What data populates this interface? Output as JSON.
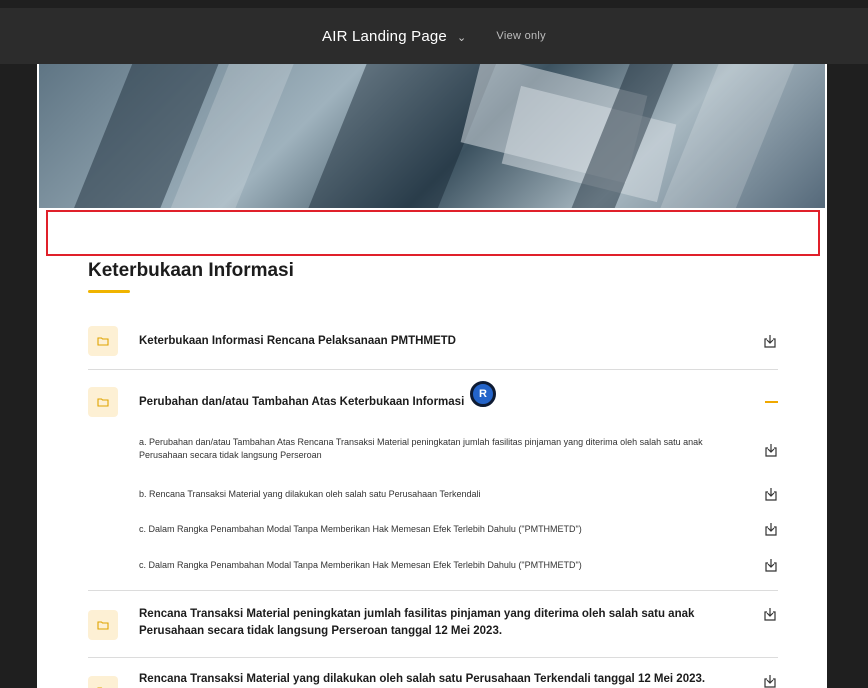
{
  "topbar": {
    "title": "AIR Landing Page",
    "chevron_icon": "chevron-down-icon",
    "mode": "View only"
  },
  "section": {
    "title": "Keterbukaan Informasi"
  },
  "items": [
    {
      "label": "Keterbukaan Informasi Rencana Pelaksanaan PMTHMETD",
      "action": "download-icon"
    },
    {
      "label": "Perubahan dan/atau Tambahan Atas Keterbukaan Informasi",
      "action": "collapse-icon",
      "children": [
        {
          "label": "a. Perubahan dan/atau Tambahan Atas Rencana Transaksi Material peningkatan jumlah fasilitas pinjaman yang diterima oleh salah satu anak Perusahaan secara tidak langsung Perseroan"
        },
        {
          "label": "b. Rencana Transaksi Material yang dilakukan oleh salah satu Perusahaan Terkendali"
        },
        {
          "label": "c. Dalam Rangka Penambahan Modal Tanpa Memberikan Hak Memesan Efek Terlebih Dahulu (\"PMTHMETD\")"
        },
        {
          "label": "c. Dalam Rangka Penambahan Modal Tanpa Memberikan Hak Memesan Efek Terlebih Dahulu (\"PMTHMETD\")"
        }
      ]
    },
    {
      "label": "Rencana Transaksi Material peningkatan jumlah fasilitas pinjaman yang diterima oleh salah satu anak Perusahaan secara tidak langsung Perseroan tanggal 12 Mei 2023.",
      "action": "download-icon"
    },
    {
      "label": "Rencana Transaksi Material yang dilakukan oleh salah satu Perusahaan Terkendali tanggal 12 Mei 2023.",
      "action": "download-icon"
    }
  ],
  "cursor": {
    "initial": "R",
    "color": "#2464c9"
  },
  "colors": {
    "accent": "#f0b400",
    "highlight_border": "#e0202a",
    "folder_bg": "#fdf0d4"
  }
}
